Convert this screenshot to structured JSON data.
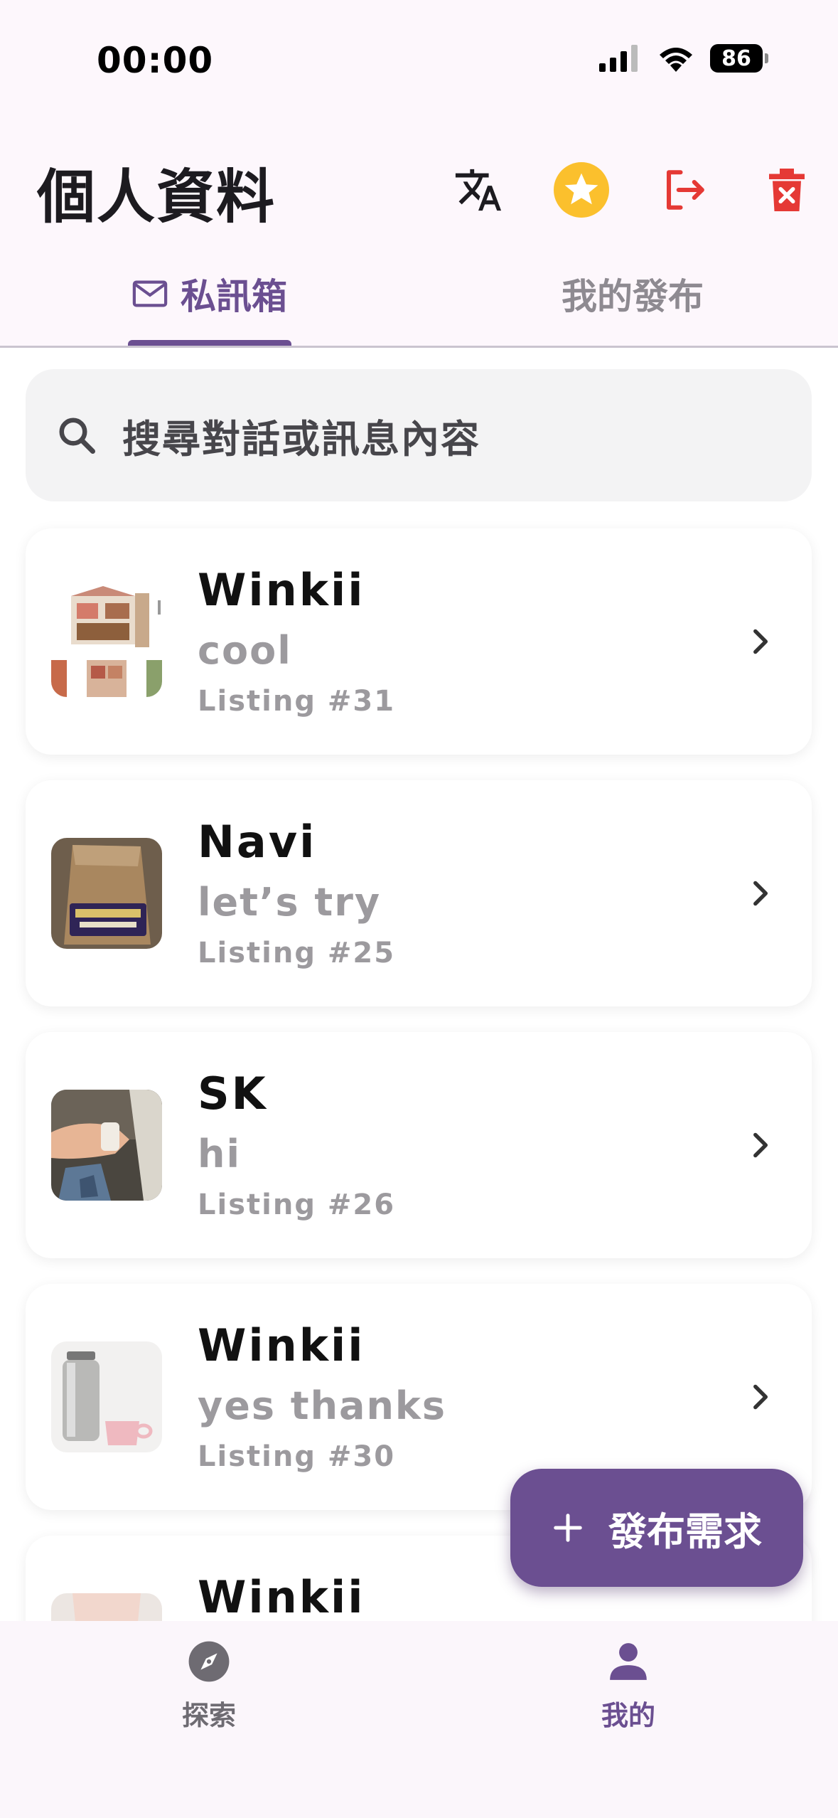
{
  "status_bar": {
    "time": "00:00",
    "battery": "86"
  },
  "header": {
    "title": "個人資料",
    "actions": [
      "translate-icon",
      "star-icon",
      "logout-icon",
      "delete-icon"
    ]
  },
  "tabs": [
    {
      "label": "私訊箱",
      "icon": "mail-icon",
      "active": true
    },
    {
      "label": "我的發布",
      "active": false
    }
  ],
  "search": {
    "placeholder": "搜尋對話或訊息內容"
  },
  "conversations": [
    {
      "name": "Winkii",
      "message": "cool",
      "listing": "Listing #31"
    },
    {
      "name": "Navi",
      "message": "let’s try",
      "listing": "Listing #25"
    },
    {
      "name": "SK",
      "message": "hi",
      "listing": "Listing #26"
    },
    {
      "name": "Winkii",
      "message": "yes thanks",
      "listing": "Listing #30"
    },
    {
      "name": "Winkii",
      "message": "",
      "listing": ""
    }
  ],
  "fab": {
    "label": "發布需求"
  },
  "bottom_nav": [
    {
      "label": "探索",
      "icon": "compass-icon",
      "active": false
    },
    {
      "label": "我的",
      "icon": "person-icon",
      "active": true
    }
  ],
  "colors": {
    "primary": "#6b4f91",
    "star": "#fbc02d",
    "logout": "#e53935",
    "delete": "#e53935"
  }
}
